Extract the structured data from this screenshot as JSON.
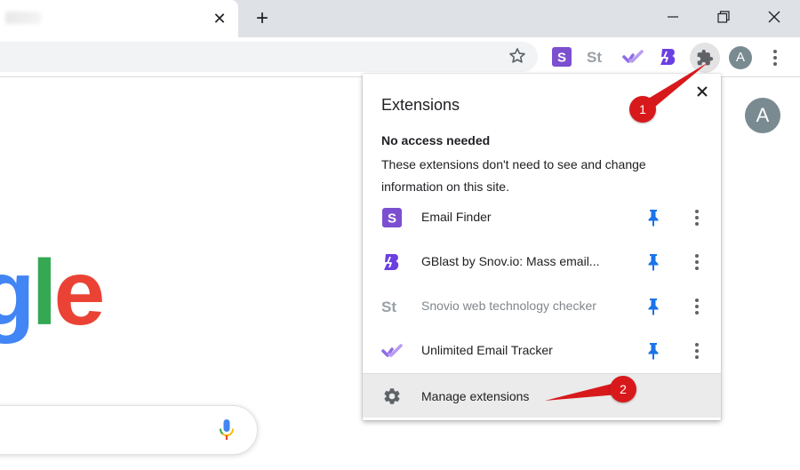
{
  "browser": {
    "tab_close_glyph": "✕",
    "new_tab_glyph": "+"
  },
  "toolbar": {
    "extension_icons": [
      "S",
      "St"
    ],
    "profile_initial": "A"
  },
  "page": {
    "avatar_initial": "A",
    "logo_fragment": {
      "g": "g",
      "l": "l",
      "e": "e"
    }
  },
  "popup": {
    "title": "Extensions",
    "section_heading": "No access needed",
    "section_description": "These extensions don't need to see and change information on this site.",
    "extensions": [
      {
        "name": "Email Finder",
        "icon": "S"
      },
      {
        "name": "GBlast by Snov.io: Mass email..."
      },
      {
        "name": "Snovio web technology checker",
        "icon": "St"
      },
      {
        "name": "Unlimited Email Tracker"
      }
    ],
    "manage_label": "Manage extensions"
  },
  "annotations": {
    "badge_1": "1",
    "badge_2": "2"
  },
  "colors": {
    "accent_blue": "#1a73e8",
    "snov_purple": "#7b4fd0",
    "callout_red": "#d8191c"
  }
}
